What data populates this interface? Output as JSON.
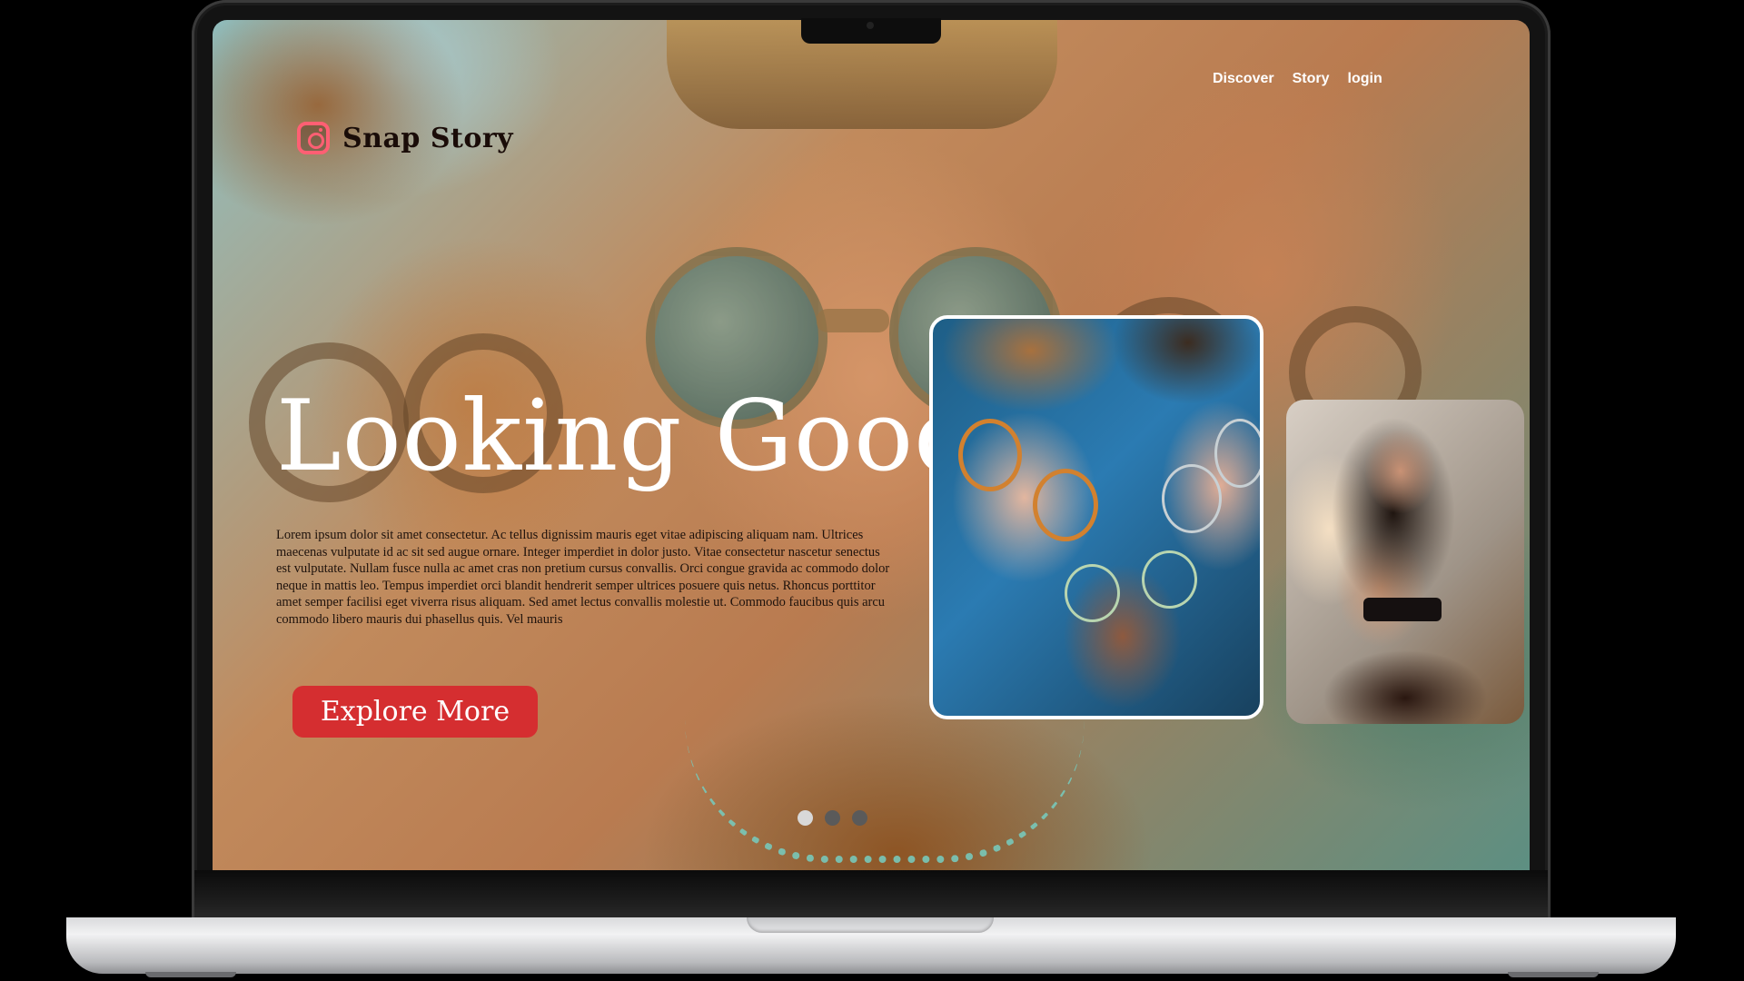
{
  "brand": {
    "name": "Snap Story",
    "logo_icon": "instagram-camera-icon",
    "logo_color": "#ff5f73"
  },
  "nav": {
    "items": [
      "Discover",
      "Story",
      "login"
    ]
  },
  "hero": {
    "title": "Looking Good",
    "body": "Lorem ipsum dolor sit amet consectetur. Ac tellus dignissim mauris eget vitae adipiscing aliquam nam. Ultrices maecenas vulputate id ac sit sed augue ornare. Integer imperdiet in dolor justo. Vitae consectetur nascetur senectus est vulputate. Nullam fusce nulla ac amet cras non pretium cursus convallis. Orci congue gravida ac commodo dolor neque in mattis leo. Tempus imperdiet orci blandit hendrerit semper ultrices posuere quis netus. Rhoncus porttitor amet semper facilisi eget viverra risus aliquam. Sed amet lectus convallis molestie ut. Commodo faucibus quis arcu commodo libero mauris dui phasellus quis. Vel mauris",
    "cta_label": "Explore More",
    "cta_color": "#d52e30"
  },
  "carousel": {
    "total": 3,
    "active": 1
  },
  "cards": {
    "main_border_color": "#ffffff"
  }
}
